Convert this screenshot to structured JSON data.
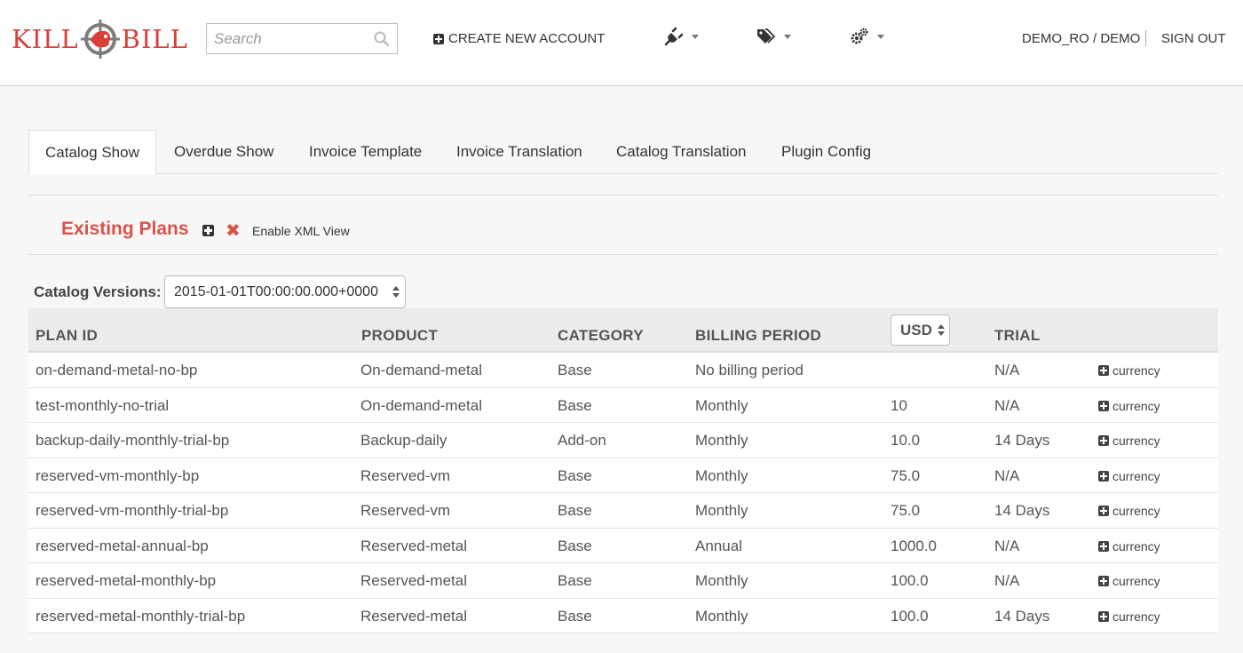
{
  "header": {
    "logo_text_left": "KILL",
    "logo_text_right": "BILL",
    "search_placeholder": "Search",
    "create_account_label": "CREATE NEW ACCOUNT",
    "user_label": "DEMO_RO / DEMO",
    "signout_label": "SIGN OUT",
    "icons": [
      "plug-icon",
      "tags-icon",
      "gears-icon"
    ]
  },
  "tabs": [
    {
      "label": "Catalog Show",
      "active": true
    },
    {
      "label": "Overdue Show",
      "active": false
    },
    {
      "label": "Invoice Template",
      "active": false
    },
    {
      "label": "Invoice Translation",
      "active": false
    },
    {
      "label": "Catalog Translation",
      "active": false
    },
    {
      "label": "Plugin Config",
      "active": false
    }
  ],
  "section": {
    "title": "Existing Plans",
    "xml_label": "Enable XML View"
  },
  "catalog": {
    "versions_label": "Catalog Versions:",
    "selected_version": "2015-01-01T00:00:00.000+0000"
  },
  "table": {
    "headers": {
      "plan_id": "PLAN ID",
      "product": "PRODUCT",
      "category": "CATEGORY",
      "billing_period": "BILLING PERIOD",
      "currency": "USD",
      "trial": "TRIAL"
    },
    "action_label": "currency",
    "rows": [
      {
        "plan_id": "on-demand-metal-no-bp",
        "product": "On-demand-metal",
        "category": "Base",
        "billing_period": "No billing period",
        "price": "",
        "trial": "N/A"
      },
      {
        "plan_id": "test-monthly-no-trial",
        "product": "On-demand-metal",
        "category": "Base",
        "billing_period": "Monthly",
        "price": "10",
        "trial": "N/A"
      },
      {
        "plan_id": "backup-daily-monthly-trial-bp",
        "product": "Backup-daily",
        "category": "Add-on",
        "billing_period": "Monthly",
        "price": "10.0",
        "trial": "14 Days"
      },
      {
        "plan_id": "reserved-vm-monthly-bp",
        "product": "Reserved-vm",
        "category": "Base",
        "billing_period": "Monthly",
        "price": "75.0",
        "trial": "N/A"
      },
      {
        "plan_id": "reserved-vm-monthly-trial-bp",
        "product": "Reserved-vm",
        "category": "Base",
        "billing_period": "Monthly",
        "price": "75.0",
        "trial": "14 Days"
      },
      {
        "plan_id": "reserved-metal-annual-bp",
        "product": "Reserved-metal",
        "category": "Base",
        "billing_period": "Annual",
        "price": "1000.0",
        "trial": "N/A"
      },
      {
        "plan_id": "reserved-metal-monthly-bp",
        "product": "Reserved-metal",
        "category": "Base",
        "billing_period": "Monthly",
        "price": "100.0",
        "trial": "N/A"
      },
      {
        "plan_id": "reserved-metal-monthly-trial-bp",
        "product": "Reserved-metal",
        "category": "Base",
        "billing_period": "Monthly",
        "price": "100.0",
        "trial": "14 Days"
      }
    ]
  },
  "colors": {
    "brand_red": "#d8413a",
    "section_title": "#d8534a"
  }
}
